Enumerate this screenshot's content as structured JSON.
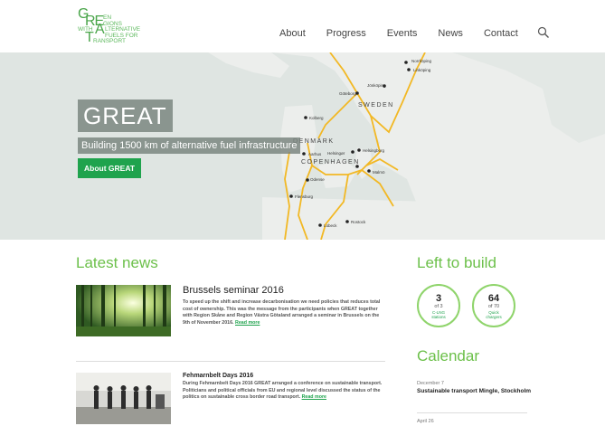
{
  "logo": {
    "g": "G",
    "re": "RE",
    "en": "EN",
    "gions": "GIONS",
    "with": "WITH",
    "a": "A",
    "lternative": "LTERNATIVE",
    "fuels_for": "FUELS FOR",
    "t": "T",
    "ransport": "RANSPORT"
  },
  "nav": {
    "items": [
      "About",
      "Progress",
      "Events",
      "News",
      "Contact"
    ]
  },
  "hero": {
    "title": "GREAT",
    "subtitle": "Building 1500 km of alternative fuel infrastructure",
    "button": "About GREAT",
    "map_labels": {
      "norrkoping": "Norrköping",
      "linkoping": "Linköping",
      "jonkoping": "Jönköping",
      "goteborg": "Göteborg",
      "sweden": "SWEDEN",
      "kolberg": "Kolberg",
      "denmark": "DENMARK",
      "aarhus": "Aarhus",
      "helsingor": "Helsingør",
      "helsingborg": "Helsingborg",
      "copenhagen": "COPENHAGEN",
      "malmo": "Malmö",
      "odense": "Odense",
      "flensburg": "Flensburg",
      "lubeck": "Lübeck",
      "rostock": "Rostock"
    }
  },
  "news": {
    "title": "Latest news",
    "items": [
      {
        "headline": "Brussels seminar 2016",
        "body": "To speed up the shift and increase decarbonisation we need policies that reduces total cost of ownership. This was the message from the participants when GREAT together with Region Skåne and Region Västra Götaland arranged a seminar in Brussels on the 9th of November 2016.",
        "more": "Read more"
      },
      {
        "headline": "Fehmarnbelt Days 2016",
        "body": "During Fehmarnbelt Days 2016 GREAT arranged a conference on sustainable transport. Politicians and political officials from EU and regional level discussed the status of the politics on sustainable cross border road transport.",
        "more": "Read more"
      }
    ]
  },
  "left_to_build": {
    "title": "Left to build",
    "counters": [
      {
        "num": "3",
        "of": "of 3",
        "label1": "C-LNG",
        "label2": "stations"
      },
      {
        "num": "64",
        "of": "of 70",
        "label1": "Quick",
        "label2": "chargers"
      }
    ]
  },
  "calendar": {
    "title": "Calendar",
    "events": [
      {
        "date": "December 7",
        "title": "Sustainable transport Mingle, Stockholm"
      },
      {
        "date": "April 26",
        "title": ""
      }
    ]
  },
  "colors": {
    "brand_green": "#6cc04a",
    "button_green": "#1fa34d",
    "route_yellow": "#f2b824"
  }
}
